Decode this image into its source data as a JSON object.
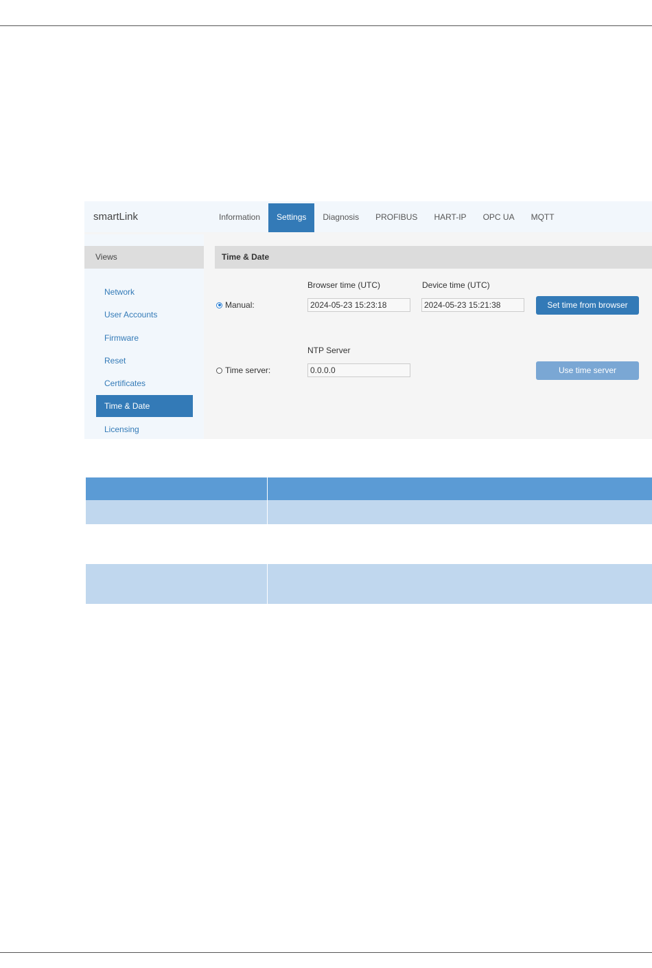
{
  "app": {
    "brand": "smartLink",
    "nav": [
      {
        "label": "Information",
        "active": false
      },
      {
        "label": "Settings",
        "active": true
      },
      {
        "label": "Diagnosis",
        "active": false
      },
      {
        "label": "PROFIBUS",
        "active": false
      },
      {
        "label": "HART-IP",
        "active": false
      },
      {
        "label": "OPC UA",
        "active": false
      },
      {
        "label": "MQTT",
        "active": false
      }
    ],
    "sidebar": {
      "header": "Views",
      "items": [
        {
          "label": "Network",
          "active": false
        },
        {
          "label": "User Accounts",
          "active": false
        },
        {
          "label": "Firmware",
          "active": false
        },
        {
          "label": "Reset",
          "active": false
        },
        {
          "label": "Certificates",
          "active": false
        },
        {
          "label": "Time & Date",
          "active": true
        },
        {
          "label": "Licensing",
          "active": false
        }
      ]
    },
    "panel": {
      "title": "Time & Date",
      "manual": {
        "radio_label": "Manual:",
        "selected": true,
        "browser_time_label": "Browser time (UTC)",
        "browser_time_value": "2024-05-23 15:23:18",
        "device_time_label": "Device time (UTC)",
        "device_time_value": "2024-05-23 15:21:38",
        "button_label": "Set time from browser"
      },
      "time_server": {
        "radio_label": "Time server:",
        "selected": false,
        "ntp_label": "NTP Server",
        "ntp_value": "0.0.0.0",
        "button_label": "Use time server",
        "button_enabled": false
      }
    },
    "colors": {
      "accent": "#337ab7",
      "accent_disabled": "#7aa7d4",
      "table_header": "#5b9bd5",
      "table_row": "#c0d7ee"
    }
  }
}
